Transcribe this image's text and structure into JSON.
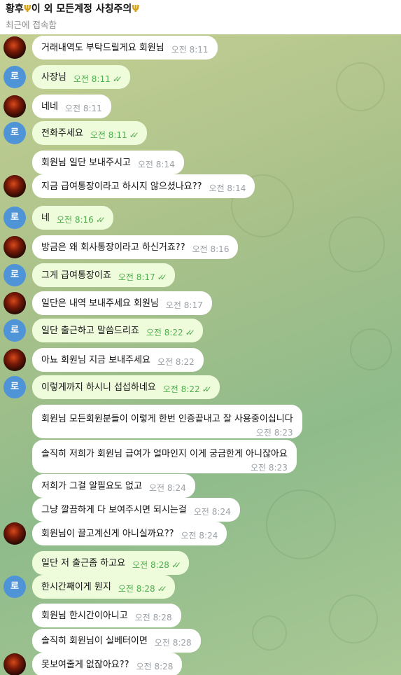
{
  "header": {
    "title_part1": "황후",
    "title_part2": "이 외 모든계정 사칭주의",
    "trident_glyph": "Ψ",
    "subtitle": "최근에 접속함"
  },
  "me_avatar_letter": "로",
  "colors": {
    "incoming_bubble": "#ffffff",
    "outgoing_bubble": "#effcdc",
    "time_in": "#9aa0a6",
    "time_out": "#4fae4e",
    "my_avatar": "#4f94d6"
  },
  "messages": [
    {
      "text": "거래내역도 부탁드릴게요 회원님",
      "time": "오전 8:11",
      "dir": "in"
    },
    {
      "text": "사장님",
      "time": "오전 8:11",
      "dir": "out"
    },
    {
      "text": "네네",
      "time": "오전 8:11",
      "dir": "in"
    },
    {
      "text": "전화주세요",
      "time": "오전 8:11",
      "dir": "out"
    },
    {
      "text": "회원님 일단 보내주시고",
      "time": "오전 8:14",
      "dir": "in"
    },
    {
      "text": "지금 급여통장이라고 하시지 않으셨나요??",
      "time": "오전 8:14",
      "dir": "in"
    },
    {
      "text": "네",
      "time": "오전 8:16",
      "dir": "out"
    },
    {
      "text": "방금은 왜 회사통장이라고 하신거죠??",
      "time": "오전 8:16",
      "dir": "in"
    },
    {
      "text": "그게 급여통장이죠",
      "time": "오전 8:17",
      "dir": "out"
    },
    {
      "text": "일단은 내역 보내주세요 회원님",
      "time": "오전 8:17",
      "dir": "in"
    },
    {
      "text": "일단 출근하고 말씀드리죠",
      "time": "오전 8:22",
      "dir": "out"
    },
    {
      "text": "아뇨 회원님 지금 보내주세요",
      "time": "오전 8:22",
      "dir": "in"
    },
    {
      "text": "이렇게까지 하시니 섭섭하네요",
      "time": "오전 8:22",
      "dir": "out"
    },
    {
      "text": "회원님 모든회원분들이 이렇게 한번 인증끝내고 잘 사용중이십니다",
      "time": "오전 8:23",
      "dir": "in"
    },
    {
      "text": "솔직히 저희가 회원님 급여가 얼마인지 이게 궁금한게 아니잖아요",
      "time": "오전 8:23",
      "dir": "in"
    },
    {
      "text": "저희가 그걸 알필요도 없고",
      "time": "오전 8:24",
      "dir": "in"
    },
    {
      "text": "그냥 깔끔하게 다 보여주시면 되시는걸",
      "time": "오전 8:24",
      "dir": "in"
    },
    {
      "text": "회원님이 끌고계신게 아니실까요??",
      "time": "오전 8:24",
      "dir": "in"
    },
    {
      "text": "일단 저 출근좀 하고요",
      "time": "오전 8:28",
      "dir": "out"
    },
    {
      "text": "한시간째이게 뭔지",
      "time": "오전 8:28",
      "dir": "out"
    },
    {
      "text": "회원님 한시간이아니고",
      "time": "오전 8:28",
      "dir": "in"
    },
    {
      "text": "솔직히 회원님이 실베터이면",
      "time": "오전 8:28",
      "dir": "in"
    },
    {
      "text": "못보여줄게 없잖아요??",
      "time": "오전 8:28",
      "dir": "in"
    }
  ]
}
